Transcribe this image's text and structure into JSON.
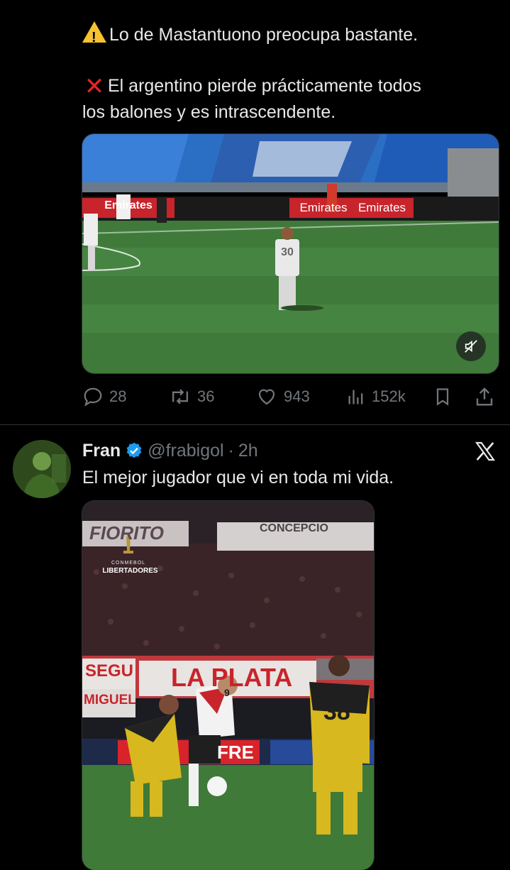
{
  "tweet1": {
    "line1": "Lo de Mastantuono preocupa bastante.",
    "line2a": "El argentino pierde prácticamente todos",
    "line2b": "los balones y es intrascendente.",
    "video": {
      "banner_left": "Emirates",
      "banner_mid": "Emirates",
      "banner_right": "Emirates",
      "player_number": "30",
      "mute_icon": "mute-icon"
    },
    "stats": {
      "replies": "28",
      "reposts": "36",
      "likes": "943",
      "views": "152k"
    }
  },
  "tweet2": {
    "name": "Fran",
    "handle": "@frabigol",
    "dot": "·",
    "time": "2h",
    "text": "El mejor jugador que vi en toda mi vida.",
    "media": {
      "logo_small": "CONMEBOL",
      "logo_big": "LIBERTADORES",
      "banner1": "FIORITO",
      "banner2": "CONCEPCIO",
      "banner3": "LA PLATA",
      "banner4": "SEGU",
      "banner5": "MIGUEL",
      "sponsor": "FRE",
      "number_left": "9",
      "number_right": "38"
    }
  },
  "colors": {
    "verified": "#1d9bf0",
    "accent_red": "#e0262c",
    "warn": "#f6c231"
  }
}
